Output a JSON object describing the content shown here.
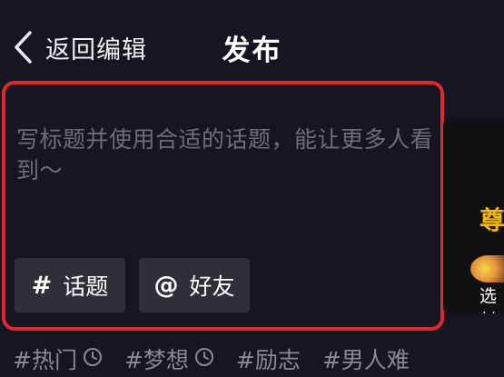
{
  "header": {
    "back_label": "返回编辑",
    "title": "发布"
  },
  "editor": {
    "placeholder": "写标题并使用合适的话题，能让更多人看到～",
    "topic_chip": {
      "glyph": "#",
      "label": "话题"
    },
    "friend_chip": {
      "glyph": "@",
      "label": "好友"
    }
  },
  "cover": {
    "title_fragment": "尊",
    "select_label": "选封"
  },
  "tags": [
    {
      "label": "#热门",
      "icon": "clock-icon"
    },
    {
      "label": "#梦想",
      "icon": "clock-icon"
    },
    {
      "label": "#励志"
    },
    {
      "label": "#男人难"
    }
  ],
  "colors": {
    "background": "#161622",
    "highlight_border": "#e5262a",
    "chip_background": "#2f2f39",
    "placeholder_text": "#6e6e78",
    "tag_text": "#8a8a95"
  }
}
